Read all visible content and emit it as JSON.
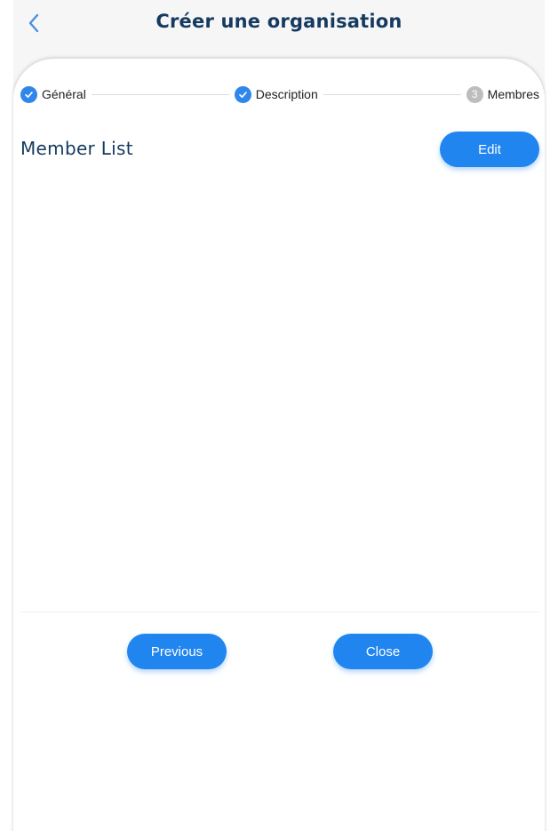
{
  "header": {
    "title": "Créer une organisation"
  },
  "stepper": {
    "steps": [
      {
        "label": "Général",
        "status": "done"
      },
      {
        "label": "Description",
        "status": "done"
      },
      {
        "label": "Membres",
        "status": "current",
        "number": "3"
      }
    ]
  },
  "members": {
    "title": "Member List",
    "edit_label": "Edit"
  },
  "footer": {
    "previous_label": "Previous",
    "close_label": "Close"
  },
  "colors": {
    "primary": "#2185f0",
    "title": "#163a5f",
    "step_done": "#2f86eb",
    "step_pending": "#bdbdbd"
  },
  "icons": {
    "back": "chevron-left-icon",
    "step_done": "check-icon"
  }
}
